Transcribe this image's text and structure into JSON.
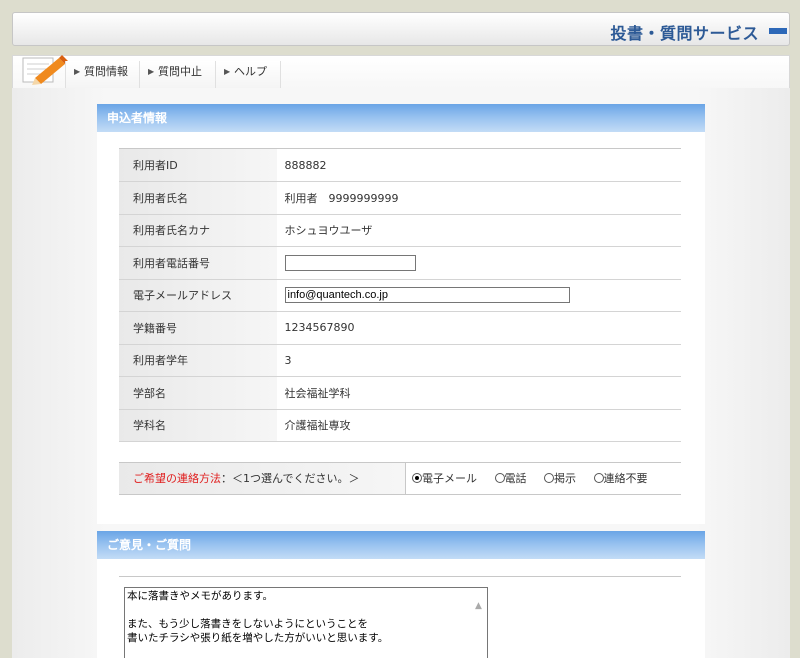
{
  "header": {
    "title": "投書・質問サービス"
  },
  "tabs": [
    {
      "label": "質問情報"
    },
    {
      "label": "質問中止"
    },
    {
      "label": "ヘルプ"
    }
  ],
  "applicant": {
    "heading": "申込者情報",
    "rows": [
      {
        "label": "利用者ID",
        "value": "888882"
      },
      {
        "label": "利用者氏名",
        "value": "利用者　9999999999"
      },
      {
        "label": "利用者氏名カナ",
        "value": "ホシュヨウユーザ"
      },
      {
        "label": "利用者電話番号",
        "value": ""
      },
      {
        "label": "電子メールアドレス",
        "value": "info@quantech.co.jp"
      },
      {
        "label": "学籍番号",
        "value": "1234567890"
      },
      {
        "label": "利用者学年",
        "value": "3"
      },
      {
        "label": "学部名",
        "value": "社会福祉学科"
      },
      {
        "label": "学科名",
        "value": "介護福祉専攻"
      }
    ]
  },
  "contact": {
    "label_red": "ご希望の連絡方法",
    "label_rest": "：＜1つ選んでください。＞",
    "options": [
      {
        "label": "電子メール",
        "selected": true
      },
      {
        "label": "電話",
        "selected": false
      },
      {
        "label": "掲示",
        "selected": false
      },
      {
        "label": "連絡不要",
        "selected": false
      }
    ]
  },
  "comments": {
    "heading": "ご意見・ご質問",
    "text": "本に落書きやメモがあります。\n\nまた、もう少し落書きをしないようにということを\n書いたチラシや張り紙を増やした方がいいと思います。"
  }
}
